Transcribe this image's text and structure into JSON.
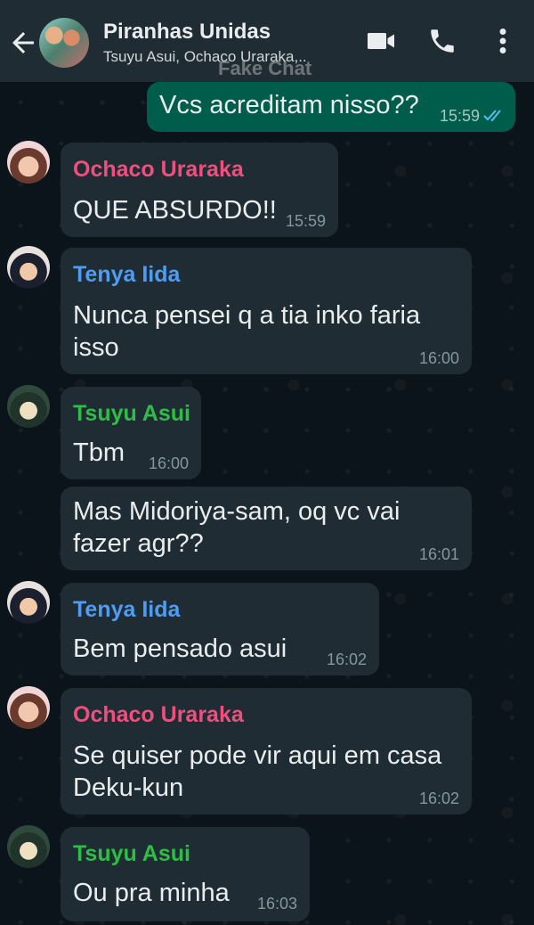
{
  "header": {
    "title": "Piranhas Unidas",
    "members": "Tsuyu Asui, Ochaco Uraraka,..",
    "watermark": "Fake Chat",
    "icons": [
      "back-arrow-icon",
      "video-call-icon",
      "phone-icon",
      "more-vert-icon"
    ]
  },
  "colors": {
    "header_bg": "#1f2c34",
    "chat_bg": "#0b141a",
    "incoming_bubble": "#1f2c34",
    "outgoing_bubble": "#005c4b",
    "ochaco": "#ef4f7d",
    "iida": "#4f9cf0",
    "tsuyu": "#2ebd45",
    "read_ticks": "#53bdeb"
  },
  "messages": [
    {
      "from": "me",
      "lines": [
        "Vcs acreditam nisso??"
      ],
      "time": "15:59",
      "status": "read"
    },
    {
      "sender": "Ochaco Uraraka",
      "lines": [
        "QUE ABSURDO!!"
      ],
      "time": "15:59"
    },
    {
      "sender": "Tenya Iida",
      "lines": [
        "Nunca pensei q a tia inko faria",
        "isso"
      ],
      "time": "16:00"
    },
    {
      "sender": "Tsuyu Asui",
      "lines": [
        "Tbm"
      ],
      "time": "16:00"
    },
    {
      "lines": [
        "Mas Midoriya-sam, oq vc vai",
        "fazer agr??"
      ],
      "time": "16:01"
    },
    {
      "sender": "Tenya Iida",
      "lines": [
        "Bem pensado asui"
      ],
      "time": "16:02"
    },
    {
      "sender": "Ochaco Uraraka",
      "lines": [
        "Se quiser pode vir aqui em casa",
        "Deku-kun"
      ],
      "time": "16:02"
    },
    {
      "sender": "Tsuyu Asui",
      "lines": [
        "Ou pra minha"
      ],
      "time": "16:03"
    }
  ]
}
